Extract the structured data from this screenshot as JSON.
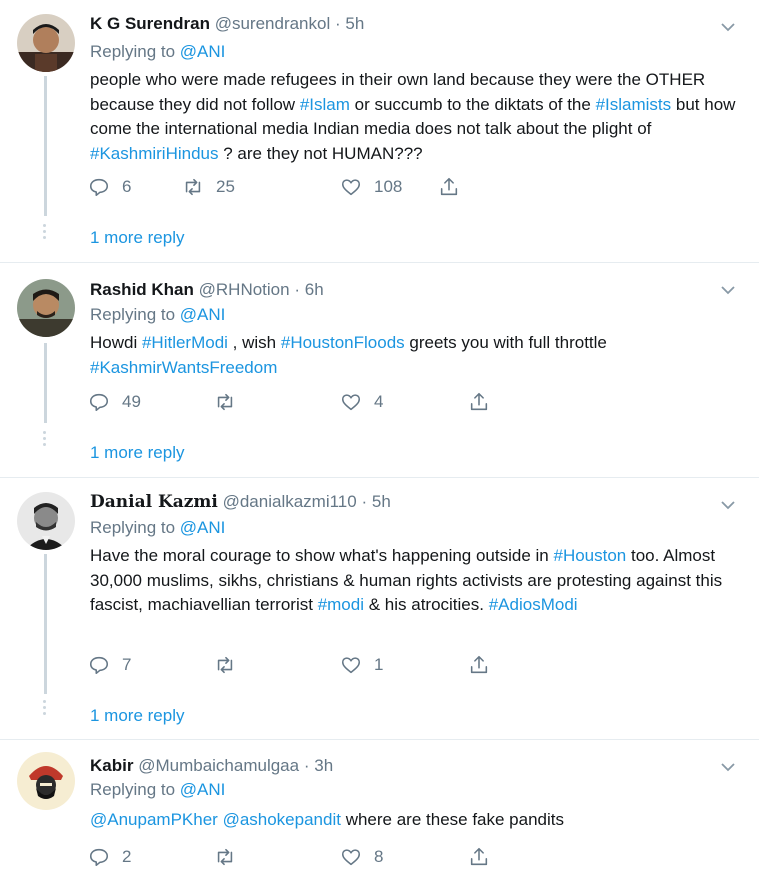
{
  "tweets": [
    {
      "name": "K G Surendran",
      "handle": "@surendrankol",
      "sep": "·",
      "time": "5h",
      "replying_label": "Replying to",
      "replying_to": "@ANI",
      "body": [
        {
          "t": "text",
          "v": "people who were made refugees in their own land because they were the OTHER because they did not follow "
        },
        {
          "t": "tag",
          "v": "#Islam"
        },
        {
          "t": "text",
          "v": " or succumb to the diktats of the "
        },
        {
          "t": "tag",
          "v": "#Islamists"
        },
        {
          "t": "text",
          "v": " but how come the international media Indian media does not talk about the plight of "
        },
        {
          "t": "tag",
          "v": "#KashmiriHindus"
        },
        {
          "t": "text",
          "v": " ? are they not HUMAN???"
        }
      ],
      "replies": "6",
      "retweets": "25",
      "likes": "108",
      "more_replies": "1 more reply",
      "avatar_colors": [
        "#6b3a2a",
        "#c9a27e"
      ]
    },
    {
      "name": "Rashid Khan",
      "handle": "@RHNotion",
      "sep": "·",
      "time": "6h",
      "replying_label": "Replying to",
      "replying_to": "@ANI",
      "body": [
        {
          "t": "text",
          "v": "Howdi "
        },
        {
          "t": "tag",
          "v": "#HitlerModi"
        },
        {
          "t": "text",
          "v": " , wish "
        },
        {
          "t": "tag",
          "v": "#HoustonFloods"
        },
        {
          "t": "text",
          "v": " greets you with full throttle "
        },
        {
          "t": "tag",
          "v": "#KashmirWantsFreedom"
        }
      ],
      "replies": "49",
      "retweets": "",
      "likes": "4",
      "more_replies": "1 more reply",
      "avatar_colors": [
        "#4a3b2b",
        "#c99b78"
      ]
    },
    {
      "name": "Danial Kazmi",
      "handle": "@danialkazmi110",
      "sep": "·",
      "time": "5h",
      "replying_label": "Replying to",
      "replying_to": "@ANI",
      "body": [
        {
          "t": "text",
          "v": "Have the moral courage to show what's happening outside in "
        },
        {
          "t": "tag",
          "v": "#Houston"
        },
        {
          "t": "text",
          "v": " too. Almost 30,000 muslims, sikhs, christians & human rights activists are protesting against this fascist, machiavellian terrorist "
        },
        {
          "t": "tag",
          "v": "#modi"
        },
        {
          "t": "text",
          "v": " & his atrocities. "
        },
        {
          "t": "tag",
          "v": "#AdiosModi"
        }
      ],
      "replies": "7",
      "retweets": "",
      "likes": "1",
      "more_replies": "1 more reply",
      "avatar_colors": [
        "#222222",
        "#dddddd"
      ]
    },
    {
      "name": "Kabir",
      "handle": "@Mumbaichamulgaa",
      "sep": "·",
      "time": "3h",
      "replying_label": "Replying to",
      "replying_to": "@ANI",
      "body": [
        {
          "t": "tag",
          "v": "@AnupamPKher"
        },
        {
          "t": "text",
          "v": " "
        },
        {
          "t": "tag",
          "v": "@ashokepandit"
        },
        {
          "t": "text",
          "v": " where are these fake pandits"
        }
      ],
      "replies": "2",
      "retweets": "",
      "likes": "8",
      "more_replies": "",
      "avatar_colors": [
        "#c0392b",
        "#f4e3b5"
      ]
    }
  ],
  "colors": {
    "link": "#1b95e0",
    "muted": "#657786",
    "text": "#14171a",
    "divider": "#e6ecf0"
  },
  "icons": [
    "reply-icon",
    "retweet-icon",
    "like-icon",
    "share-icon",
    "chevron-down-icon"
  ]
}
